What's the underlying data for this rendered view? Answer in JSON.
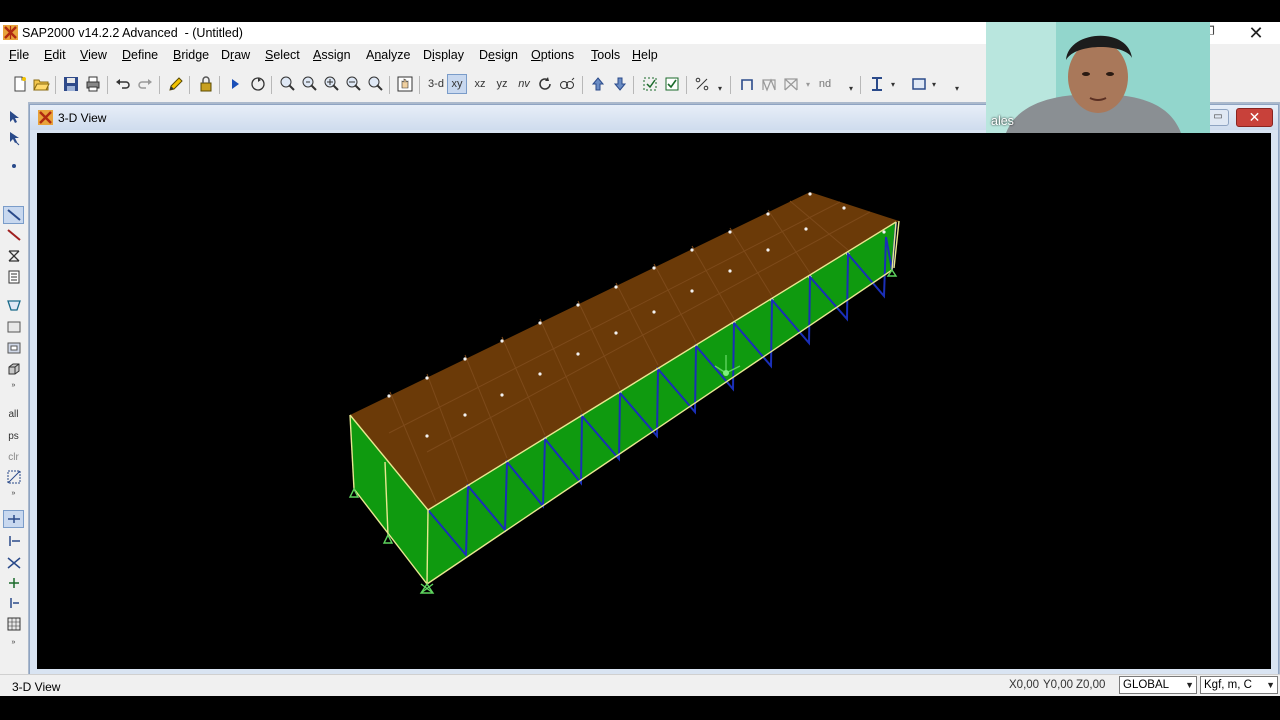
{
  "app": {
    "title": "SAP2000 v14.2.2 Advanced  - (Untitled)",
    "close_glyph": "✕"
  },
  "menu": [
    {
      "pre": "",
      "u": "F",
      "post": "ile"
    },
    {
      "pre": "",
      "u": "E",
      "post": "dit"
    },
    {
      "pre": "",
      "u": "V",
      "post": "iew"
    },
    {
      "pre": "",
      "u": "D",
      "post": "efine"
    },
    {
      "pre": "",
      "u": "B",
      "post": "ridge"
    },
    {
      "pre": "D",
      "u": "r",
      "post": "aw"
    },
    {
      "pre": "",
      "u": "S",
      "post": "elect"
    },
    {
      "pre": "",
      "u": "A",
      "post": "ssign"
    },
    {
      "pre": "A",
      "u": "n",
      "post": "alyze"
    },
    {
      "pre": "D",
      "u": "i",
      "post": "splay"
    },
    {
      "pre": "D",
      "u": "e",
      "post": "sign"
    },
    {
      "pre": "",
      "u": "O",
      "post": "ptions"
    },
    {
      "pre": "",
      "u": "T",
      "post": "ools"
    },
    {
      "pre": "",
      "u": "H",
      "post": "elp"
    }
  ],
  "toolbar": {
    "view_3d": "3-d",
    "view_xy": "xy",
    "view_xz": "xz",
    "view_yz": "yz",
    "view_nv": "nv",
    "view_nd": "nd",
    "pressed": "xy"
  },
  "left_toolbar": {
    "all": "all",
    "ps": "ps",
    "clr": "clr"
  },
  "view_window": {
    "title": "3-D View"
  },
  "status": {
    "left": "3-D View",
    "x": "X0,00",
    "y": "Y0,00",
    "z": "Z0,00",
    "coord_system": "GLOBAL",
    "units": "Kgf, m, C"
  },
  "webcam": {
    "name": "ales"
  },
  "colors": {
    "deck": "#6b3a08",
    "truss_side": "#0f9a0f",
    "bracing": "#1a2fb8",
    "members": "#e8e890",
    "background": "#000000"
  }
}
